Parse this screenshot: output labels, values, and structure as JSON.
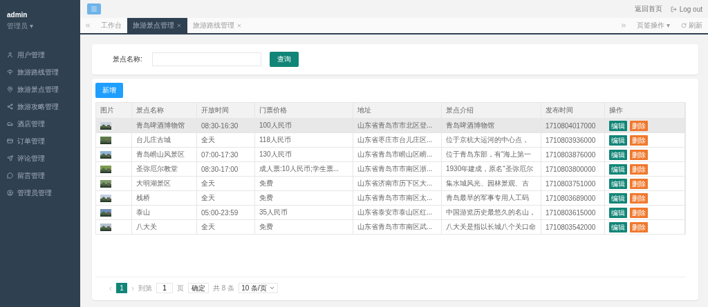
{
  "sidebar": {
    "user": "admin",
    "role": "管理员 ▾",
    "items": [
      {
        "label": "用户管理"
      },
      {
        "label": "旅游路线管理"
      },
      {
        "label": "旅游景点管理"
      },
      {
        "label": "旅游攻略管理"
      },
      {
        "label": "酒店管理"
      },
      {
        "label": "订单管理"
      },
      {
        "label": "评论管理"
      },
      {
        "label": "留言管理"
      },
      {
        "label": "管理员管理"
      }
    ]
  },
  "topbar": {
    "home_link": "返回首页",
    "logout": "Log out"
  },
  "tabs": [
    {
      "label": "工作台",
      "selected": false,
      "closable": false
    },
    {
      "label": "旅游景点管理",
      "selected": true,
      "closable": true
    },
    {
      "label": "旅游路线管理",
      "selected": false,
      "closable": true
    }
  ],
  "tab_tools": {
    "page_ops": "页签操作 ▾",
    "refresh": "刷新"
  },
  "search": {
    "label": "景点名称:",
    "button": "查询"
  },
  "add_button": "新增",
  "table": {
    "columns": [
      "图片",
      "景点名称",
      "开放时间",
      "门票价格",
      "地址",
      "景点介绍",
      "发布时间",
      "操作"
    ],
    "rows": [
      {
        "highlighted": true,
        "cells": [
          {
            "kind": "picture"
          },
          "青岛啤酒博物馆",
          "08:30-16:30",
          "100人民币",
          "山东省青岛市市北区登...",
          "青岛啤酒博物馆",
          "1710804017000",
          {
            "kind": "actions",
            "buttons": [
              "编辑",
              "删除"
            ]
          }
        ]
      },
      {
        "highlighted": false,
        "cells": [
          {
            "kind": "picture"
          },
          "台儿庄古城",
          "全天",
          "118人民币",
          "山东省枣庄市台儿庄区...",
          "位于京杭大运河的中心点，",
          "1710803936000",
          {
            "kind": "actions",
            "buttons": [
              "编辑",
              "删除"
            ]
          }
        ]
      },
      {
        "highlighted": false,
        "cells": [
          {
            "kind": "picture"
          },
          "青岛崂山风景区",
          "07:00-17:30",
          "130人民币",
          "山东省青岛市崂山区崂...",
          "位于青岛东部，有“海上第一",
          "1710803876000",
          {
            "kind": "actions",
            "buttons": [
              "编辑",
              "删除"
            ]
          }
        ]
      },
      {
        "highlighted": false,
        "cells": [
          {
            "kind": "picture"
          },
          "圣弥厄尔教堂",
          "08:30-17:00",
          "成人票:10人民币;学生票...",
          "山东省青岛市市南区浙...",
          "1930年建成，原名“圣弥厄尔",
          "1710803800000",
          {
            "kind": "actions",
            "buttons": [
              "编辑",
              "删除"
            ]
          }
        ]
      },
      {
        "highlighted": false,
        "cells": [
          {
            "kind": "picture"
          },
          "大明湖景区",
          "全天",
          "免费",
          "山东省济南市历下区大...",
          "集水城风光、园林景观、古",
          "1710803751000",
          {
            "kind": "actions",
            "buttons": [
              "编辑",
              "删除"
            ]
          }
        ]
      },
      {
        "highlighted": false,
        "cells": [
          {
            "kind": "picture"
          },
          "栈桥",
          "全天",
          "免费",
          "山东省青岛市市南区太...",
          "青岛最早的军事专用人工码",
          "1710803689000",
          {
            "kind": "actions",
            "buttons": [
              "编辑",
              "删除"
            ]
          }
        ]
      },
      {
        "highlighted": false,
        "cells": [
          {
            "kind": "picture"
          },
          "泰山",
          "05:00-23:59",
          "35人民币",
          "山东省泰安市泰山区红...",
          "中国游览历史最悠久的名山，",
          "1710803615000",
          {
            "kind": "actions",
            "buttons": [
              "编辑",
              "删除"
            ]
          }
        ]
      },
      {
        "highlighted": false,
        "cells": [
          {
            "kind": "picture"
          },
          "八大关",
          "全天",
          "免费",
          "山东省青岛市市南区武...",
          "八大关是指以长城八个关口命",
          "1710803542000",
          {
            "kind": "actions",
            "buttons": [
              "编辑",
              "删除"
            ]
          }
        ]
      }
    ]
  },
  "pagination": {
    "prev": "‹",
    "page": "1",
    "next": "›",
    "goto": "到第",
    "page_input": "1",
    "page_unit": "页",
    "confirm": "确定",
    "total": "共 8 条",
    "page_size": "10 条/页"
  }
}
